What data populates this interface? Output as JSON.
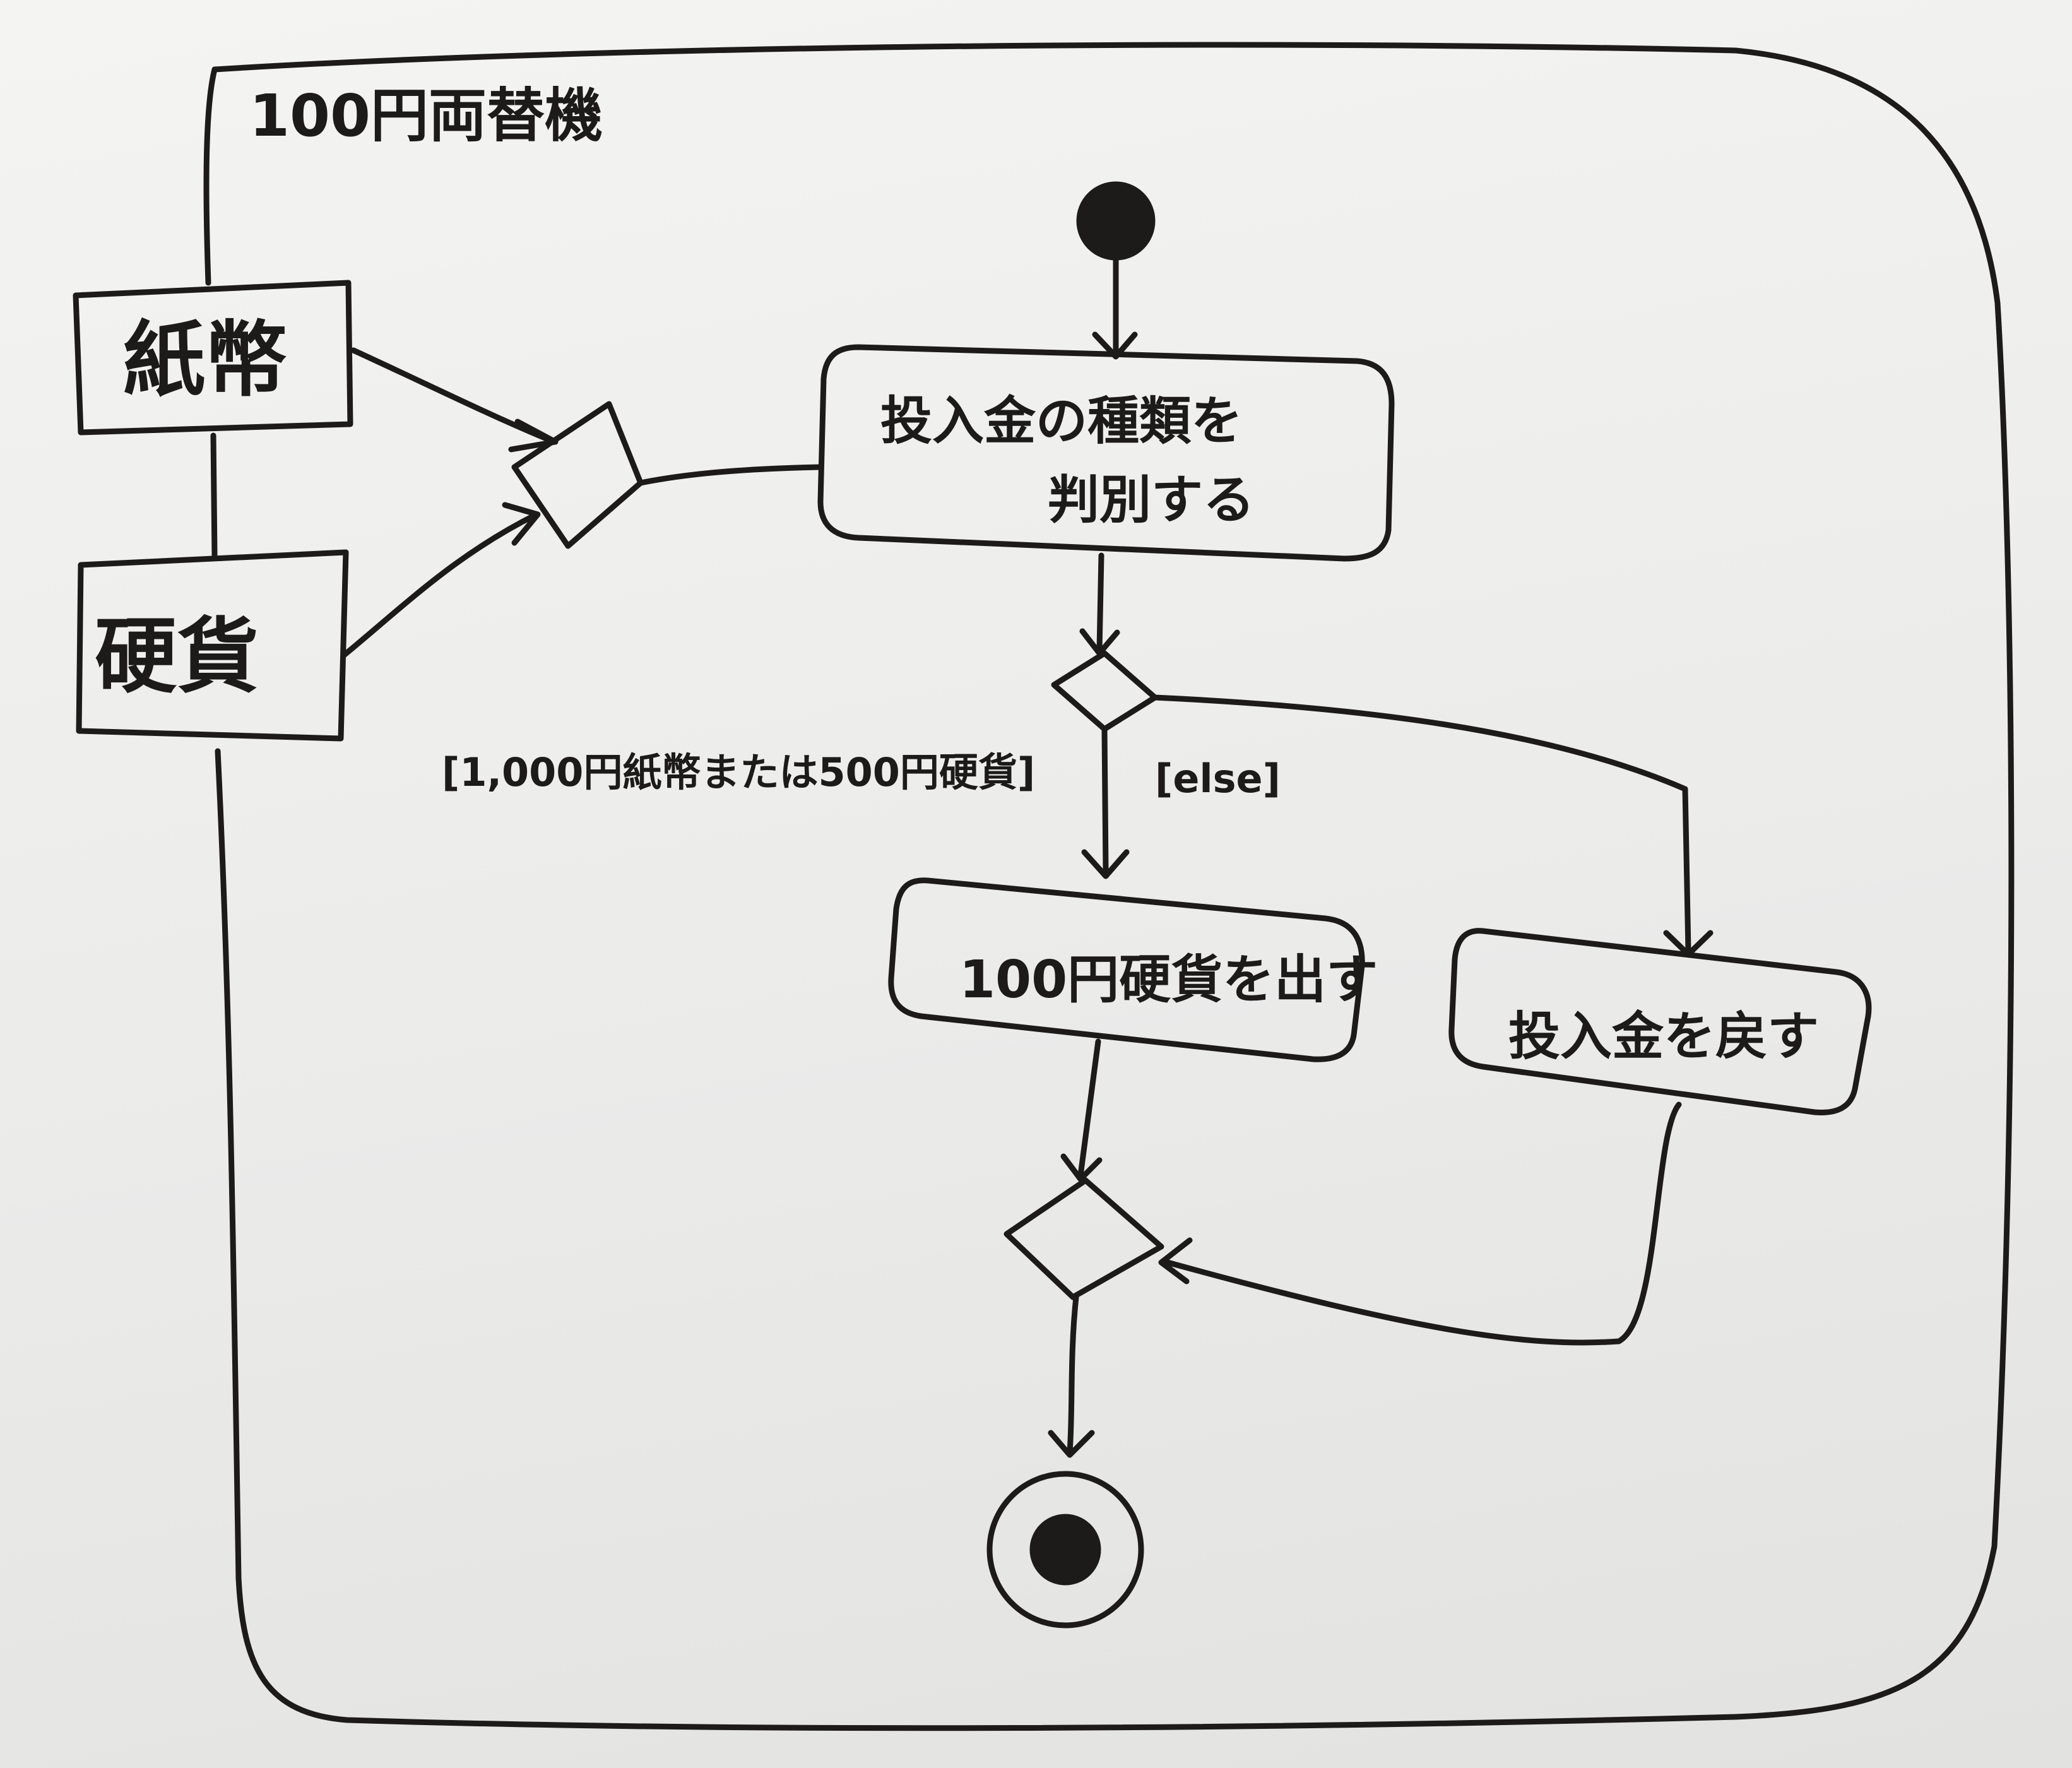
{
  "diagram": {
    "title": "100円両替機",
    "input_pins": [
      "紙幣",
      "硬貨"
    ],
    "actions": {
      "classify": [
        "投入金の種類を",
        "判別する"
      ],
      "dispense": "100円硬貨を出す",
      "return": "投入金を戻す"
    },
    "guards": {
      "accept": "[1,000円紙幣または500円硬貨]",
      "else": "[else]"
    }
  },
  "colors": {
    "ink": "#1d1a1a",
    "board": "#efefed"
  }
}
